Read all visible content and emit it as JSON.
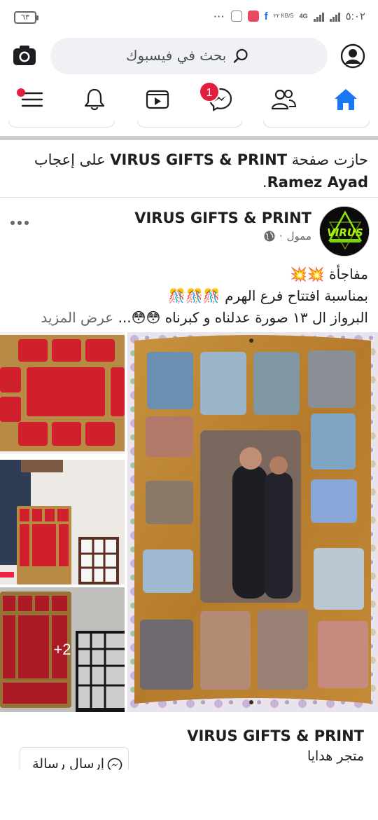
{
  "status_bar": {
    "battery": "٦٣",
    "speed": "٢٢ KB/S",
    "network": "4G",
    "time": "٥:٠٢"
  },
  "header": {
    "search_placeholder": "بحث في فيسبوك"
  },
  "nav": {
    "messenger_badge": "1",
    "active_tab": "home",
    "accent_color": "#1877f2",
    "icons": [
      "menu-icon",
      "bell-icon",
      "video-icon",
      "messenger-icon",
      "friends-icon",
      "home-icon"
    ]
  },
  "liked_banner": {
    "prefix": "حازت صفحة",
    "page": "VIRUS GIFTS & PRINT",
    "middle": "على إعجاب",
    "person": "Ramez Ayad",
    "end": "."
  },
  "post": {
    "page_name": "VIRUS GIFTS & PRINT",
    "sponsored": "ممول",
    "dot": "·",
    "avatar_text": "VIRUS",
    "line1": "مفاجأة 💥💥",
    "line2": "بمناسبة افتتاح فرع الهرم 🎊🎊🎊",
    "line3": "البرواز ال ١٣ صورة عدلناه و كبرناه 😳😳...",
    "see_more": "عرض المزيد",
    "more_photos": "+2"
  },
  "cta": {
    "name": "VIRUS GIFTS & PRINT",
    "category": "متجر هدايا",
    "button_label": "إرسال رسالة"
  }
}
